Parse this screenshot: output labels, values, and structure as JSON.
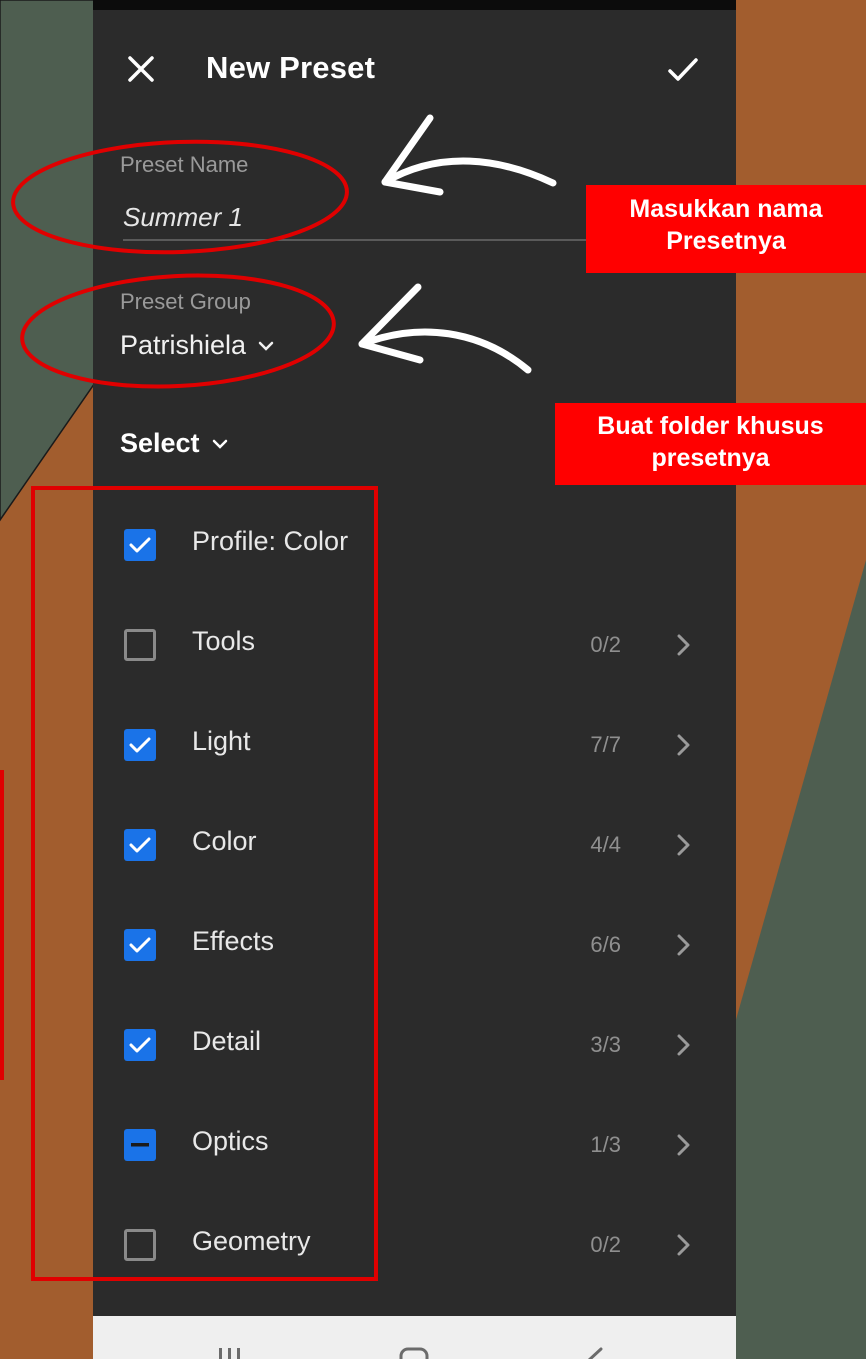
{
  "header": {
    "title": "New Preset",
    "close_icon": "close-icon",
    "confirm_icon": "checkmark-icon"
  },
  "preset_name": {
    "label": "Preset Name",
    "value": "Summer 1"
  },
  "preset_group": {
    "label": "Preset Group",
    "value": "Patrishiela"
  },
  "select": {
    "label": "Select"
  },
  "settings": [
    {
      "label": "Profile: Color",
      "state": "checked",
      "count": ""
    },
    {
      "label": "Tools",
      "state": "unchecked",
      "count": "0/2"
    },
    {
      "label": "Light",
      "state": "checked",
      "count": "7/7"
    },
    {
      "label": "Color",
      "state": "checked",
      "count": "4/4"
    },
    {
      "label": "Effects",
      "state": "checked",
      "count": "6/6"
    },
    {
      "label": "Detail",
      "state": "checked",
      "count": "3/3"
    },
    {
      "label": "Optics",
      "state": "partial",
      "count": "1/3"
    },
    {
      "label": "Geometry",
      "state": "unchecked",
      "count": "0/2"
    }
  ],
  "annotations": {
    "callout_name_line1": "Masukkan nama",
    "callout_name_line2": "Presetnya",
    "callout_group_line1": "Buat folder khusus",
    "callout_group_line2": "presetnya"
  },
  "colors": {
    "panel": "#2b2b2b",
    "accent_checkbox": "#1a73e8",
    "annotation_red": "#ff0000",
    "bg_green": "#4e5e50",
    "bg_orange": "#a25d2e"
  }
}
